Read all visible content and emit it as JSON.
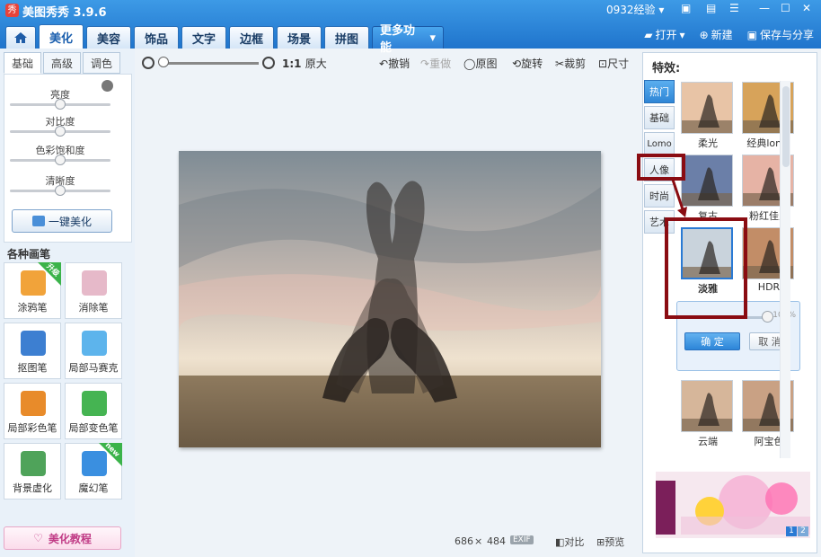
{
  "app": {
    "title": "美图秀秀 3.9.6",
    "icon_glyph": "秀",
    "user": "0932经验"
  },
  "nav": {
    "home_icon": "home-icon",
    "tabs": [
      "美化",
      "美容",
      "饰品",
      "文字",
      "边框",
      "场景",
      "拼图"
    ],
    "more_label": "更多功能",
    "actions": {
      "open": "打开",
      "new": "新建",
      "save_share": "保存与分享"
    }
  },
  "left": {
    "subtabs": [
      "基础",
      "高级",
      "调色"
    ],
    "sliders": [
      {
        "label": "亮度",
        "level": 0.5
      },
      {
        "label": "对比度",
        "level": 0.5
      },
      {
        "label": "色彩饱和度",
        "level": 0.5
      },
      {
        "label": "清晰度",
        "level": 0.5
      }
    ],
    "onekey_label": "一键美化",
    "brushes_title": "各种画笔",
    "brushes": [
      {
        "label": "涂鸦笔",
        "badge": "升级",
        "icon": "pencil-icon",
        "color": "#f1a33a"
      },
      {
        "label": "消除笔",
        "badge": "",
        "icon": "eraser-icon",
        "color": "#e6b9c9"
      },
      {
        "label": "抠图笔",
        "badge": "",
        "icon": "cutout-pen-icon",
        "color": "#3d7fd1"
      },
      {
        "label": "局部马赛克",
        "badge": "",
        "icon": "mosaic-icon",
        "color": "#5db4ec"
      },
      {
        "label": "局部彩色笔",
        "badge": "",
        "icon": "color-brush-icon",
        "color": "#e88b2a"
      },
      {
        "label": "局部变色笔",
        "badge": "",
        "icon": "paint-bucket-icon",
        "color": "#45b452"
      },
      {
        "label": "背景虚化",
        "badge": "",
        "icon": "blur-icon",
        "color": "#4fa35a"
      },
      {
        "label": "魔幻笔",
        "badge": "new",
        "icon": "magic-wand-icon",
        "color": "#3a8fe0"
      }
    ],
    "tutorial_label": "美化教程"
  },
  "toolbar": {
    "zoom_level": 0.0,
    "ratio_label": "1:1",
    "original_size": "原大",
    "undo": "撤销",
    "redo": "重做",
    "original": "原图",
    "rotate": "旋转",
    "crop": "裁剪",
    "size": "尺寸"
  },
  "status": {
    "width": "686",
    "times": "×",
    "height": "484",
    "exif": "EXIF",
    "compare": "对比",
    "preview": "预览"
  },
  "effects": {
    "title": "特效:",
    "categories": [
      "热门",
      "基础",
      "Lomo",
      "人像",
      "时尚",
      "艺术"
    ],
    "active_category": "热门",
    "items": [
      {
        "label": "柔光"
      },
      {
        "label": "经典lomo"
      },
      {
        "label": "复古"
      },
      {
        "label": "粉红佳人"
      },
      {
        "label": "淡雅"
      },
      {
        "label": "HDR"
      },
      {
        "label": "云端"
      },
      {
        "label": "阿宝色"
      }
    ],
    "opacity_pct": "100%",
    "ok_label": "确 定",
    "cancel_label": "取 消",
    "ad_pages": [
      "1",
      "2"
    ]
  },
  "colors": {
    "nav_blue": "#2a82d8",
    "highlight_red": "#8a0c12",
    "ok_blue": "#2c85d8"
  }
}
